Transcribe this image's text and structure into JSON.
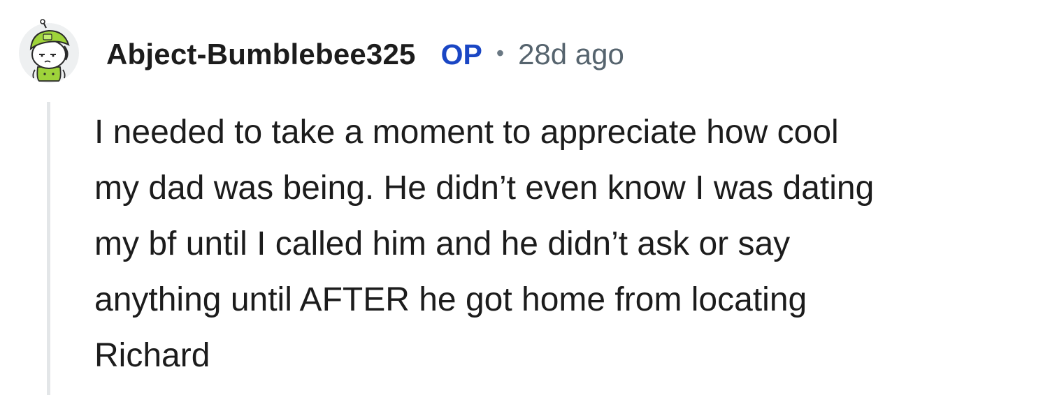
{
  "comment": {
    "author": "Abject-Bumblebee325",
    "badge": "OP",
    "separator": "•",
    "age": "28d ago",
    "avatar_icon": "snoo-avatar-icon",
    "body_lines": [
      "I needed to take a moment to appreciate how cool",
      "my dad was being. He didn’t even know I was dating",
      "my bf until I called him and he didn’t ask or say",
      "anything until AFTER he got home from locating",
      "Richard"
    ]
  },
  "colors": {
    "op_badge": "#1a46c4",
    "timestamp": "#56646e",
    "thread_line": "#e3e6e8",
    "text": "#1c1c1c",
    "avatar_hat": "#9ed33a"
  }
}
